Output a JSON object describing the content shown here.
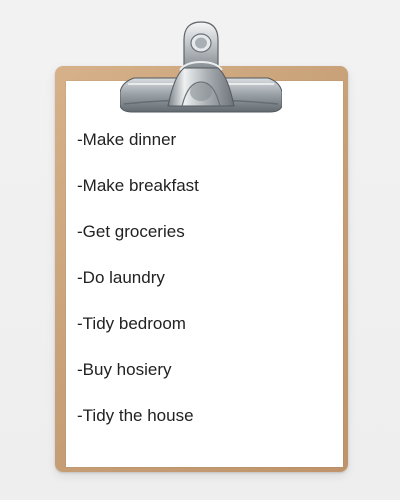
{
  "checklist": {
    "items": [
      "-Make dinner",
      "-Make breakfast",
      "-Get groceries",
      "-Do laundry",
      "-Tidy bedroom",
      "-Buy hosiery",
      "-Tidy the house"
    ]
  },
  "colors": {
    "background": "#f0f0f0",
    "board": "#c8a178",
    "paper": "#ffffff",
    "clip_metal": "#bfc4c8",
    "text": "#222222"
  },
  "icons": {
    "clip": "metal-clip-icon"
  }
}
